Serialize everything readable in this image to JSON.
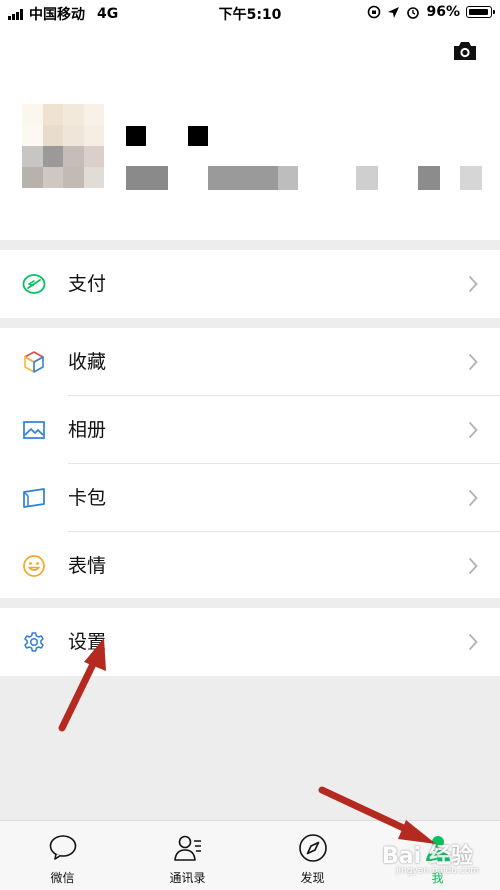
{
  "status_bar": {
    "carrier": "中国移动",
    "network": "4G",
    "time": "下午5:10",
    "battery": "96%"
  },
  "profile": {
    "camera_icon": "camera-icon",
    "avatar_colors": [
      "#fbf6ee",
      "#efe3cf",
      "#f3e9db",
      "#f8f1e8",
      "#fdf9f2",
      "#e8dccb",
      "#efe5d8",
      "#f6eee3",
      "#c8c6c3",
      "#9c9a98",
      "#c6bdb8",
      "#dccfcb",
      "#b7b2aa",
      "#cfc8c2",
      "#c2bab3",
      "#e2dcd7"
    ]
  },
  "menu": {
    "pay": {
      "label": "支付",
      "icon": "pay-icon"
    },
    "favorites": {
      "label": "收藏",
      "icon": "cube-icon"
    },
    "album": {
      "label": "相册",
      "icon": "picture-icon"
    },
    "cards": {
      "label": "卡包",
      "icon": "wallet-icon"
    },
    "stickers": {
      "label": "表情",
      "icon": "smiley-icon"
    },
    "settings": {
      "label": "设置",
      "icon": "gear-icon"
    }
  },
  "tabbar": {
    "chats": "微信",
    "contacts": "通讯录",
    "discover": "发现",
    "me": "我"
  },
  "colors": {
    "accent": "#07c160",
    "arrow": "#b52a20",
    "background": "#ededed"
  },
  "watermark": {
    "text": "Bai 经验",
    "sub": "jingyan.baidu.com"
  }
}
